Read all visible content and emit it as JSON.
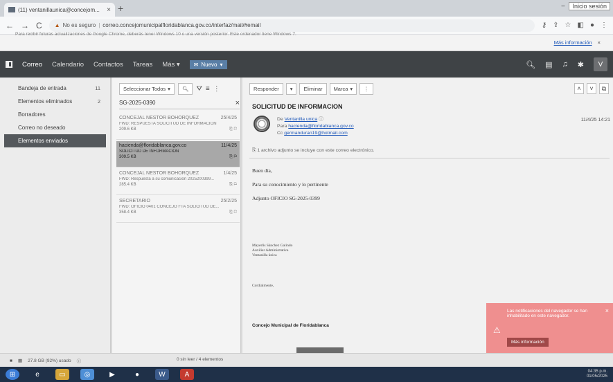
{
  "browser": {
    "tab_title": "(11) ventanillaunica@concejom...",
    "tab_close": "×",
    "new_tab": "+",
    "window_close_label": "Inicio sesión",
    "address": {
      "security": "No es seguro",
      "url": "correo.concejomunicipalfloridablanca.gov.co/interfaz/mail/#email"
    }
  },
  "infobar": {
    "message": "Para recibir futuras actualizaciones de Google Chrome, deberás tener Windows 10 o una versión posterior. Este ordenador tiene Windows 7.",
    "link": "Más información",
    "close": "×"
  },
  "app": {
    "nav": [
      "Correo",
      "Calendario",
      "Contactos",
      "Tareas",
      "Más"
    ],
    "nuevo": "Nuevo",
    "avatar": "V"
  },
  "sidebar": {
    "folders": [
      {
        "label": "Bandeja de entrada",
        "count": "11"
      },
      {
        "label": "Elementos eliminados",
        "count": "2"
      },
      {
        "label": "Borradores",
        "count": ""
      },
      {
        "label": "Correo no deseado",
        "count": ""
      },
      {
        "label": "Elementos enviados",
        "count": ""
      }
    ]
  },
  "list": {
    "select_all": "Seleccionar Todos",
    "search_value": "SG-2025-0390",
    "messages": [
      {
        "from": "CONCEJAL NESTOR BOHORQUEZ",
        "date": "25/4/25",
        "subject": "FWD: RESPUESTA SOLICITUD DE INFORMACION",
        "size": "209.6 KB"
      },
      {
        "from": "hacienda@floridablanca.gov.co",
        "date": "11/4/25",
        "subject": "SOLICITUD DE INFORMACION",
        "size": "309.5 KB"
      },
      {
        "from": "CONCEJAL NESTOR BOHORQUEZ",
        "date": "1/4/25",
        "subject": "FWD: Respuesta a su comunicación 2025200399...",
        "size": "285.4 KB"
      },
      {
        "from": "SECRETARIO",
        "date": "25/2/25",
        "subject": "FWD: OFICIO 0401 CONCEJO FTA SOLICITUD DE...",
        "size": "358.4 KB"
      }
    ]
  },
  "reader": {
    "responder": "Responder",
    "eliminar": "Eliminar",
    "marca": "Marca",
    "subject": "SOLICITUD DE INFORMACION",
    "de_label": "De",
    "de_value": "Ventanilla unica",
    "para_label": "Para",
    "para_value": "hacienda@floridablanca.gov.co",
    "cc_label": "Cc",
    "cc_value": "germanduran19@hotmail.com",
    "date": "11/4/25 14:21",
    "attachment_note": "1 archivo adjunto se incluye con este correo electrónico.",
    "greeting": "Buen día,",
    "line2": "Para su conocimiento y lo pertinente",
    "adjunto": "Adjunto  OFICIO SG-2025-0399",
    "sig_name": "Mayerlis Sánchez Galindo",
    "sig_role": "Auxiliar Administrativa",
    "sig_dept": "Ventanilla única",
    "closing": "Cordialmente,",
    "org": "Concejo Municipal de Floridablanca"
  },
  "notification": {
    "text": "Las notificaciones del navegador se han inhabilitado en este navegador.",
    "button": "Más información",
    "close": "×"
  },
  "status": {
    "storage": "27.8 GB (92%) usado",
    "counts": "0 sin leer / 4 elementos"
  },
  "taskbar": {
    "time": "04:35 p.m.",
    "date": "01/05/2025"
  }
}
